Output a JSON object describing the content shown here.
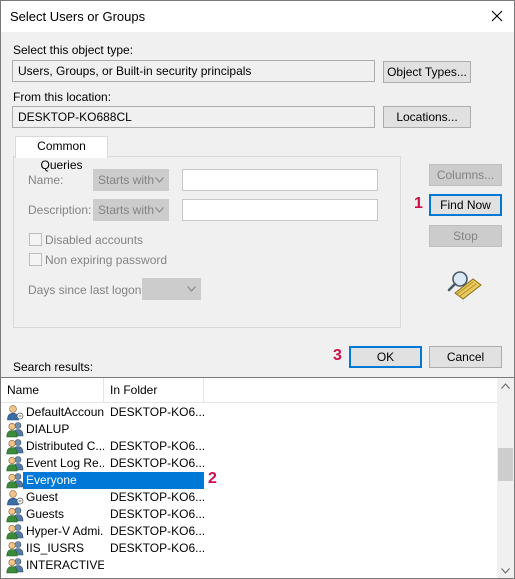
{
  "window": {
    "title": "Select Users or Groups"
  },
  "object_type": {
    "label": "Select this object type:",
    "value": "Users, Groups, or Built-in security principals",
    "button": "Object Types..."
  },
  "location": {
    "label": "From this location:",
    "value": "DESKTOP-KO688CL",
    "button": "Locations..."
  },
  "common_queries": {
    "tab_label": "Common Queries",
    "name_label": "Name:",
    "name_mode": "Starts with",
    "description_label": "Description:",
    "description_mode": "Starts with",
    "disabled_accounts": "Disabled accounts",
    "non_expiring_password": "Non expiring password",
    "days_since_logon": "Days since last logon:"
  },
  "side_buttons": {
    "columns": "Columns...",
    "find_now": "Find Now",
    "stop": "Stop"
  },
  "search_results_label": "Search results:",
  "ok": "OK",
  "cancel": "Cancel",
  "markers": {
    "find_now": "1",
    "everyone": "2",
    "ok": "3"
  },
  "results": {
    "columns": [
      "Name",
      "In Folder"
    ],
    "rows": [
      {
        "name": "DefaultAccount",
        "folder": "DESKTOP-KO6...",
        "icon": "user-icon"
      },
      {
        "name": "DIALUP",
        "folder": "",
        "icon": "group-icon"
      },
      {
        "name": "Distributed C...",
        "folder": "DESKTOP-KO6...",
        "icon": "group-icon"
      },
      {
        "name": "Event Log Re...",
        "folder": "DESKTOP-KO6...",
        "icon": "group-icon"
      },
      {
        "name": "Everyone",
        "folder": "",
        "icon": "group-icon",
        "selected": true
      },
      {
        "name": "Guest",
        "folder": "DESKTOP-KO6...",
        "icon": "user-icon"
      },
      {
        "name": "Guests",
        "folder": "DESKTOP-KO6...",
        "icon": "group-icon"
      },
      {
        "name": "Hyper-V Admi...",
        "folder": "DESKTOP-KO6...",
        "icon": "group-icon"
      },
      {
        "name": "IIS_IUSRS",
        "folder": "DESKTOP-KO6...",
        "icon": "group-icon"
      },
      {
        "name": "INTERACTIVE",
        "folder": "",
        "icon": "group-icon"
      }
    ]
  },
  "colors": {
    "selection": "#0078d7",
    "marker": "#d0104c",
    "default_border": "#0078d7"
  }
}
